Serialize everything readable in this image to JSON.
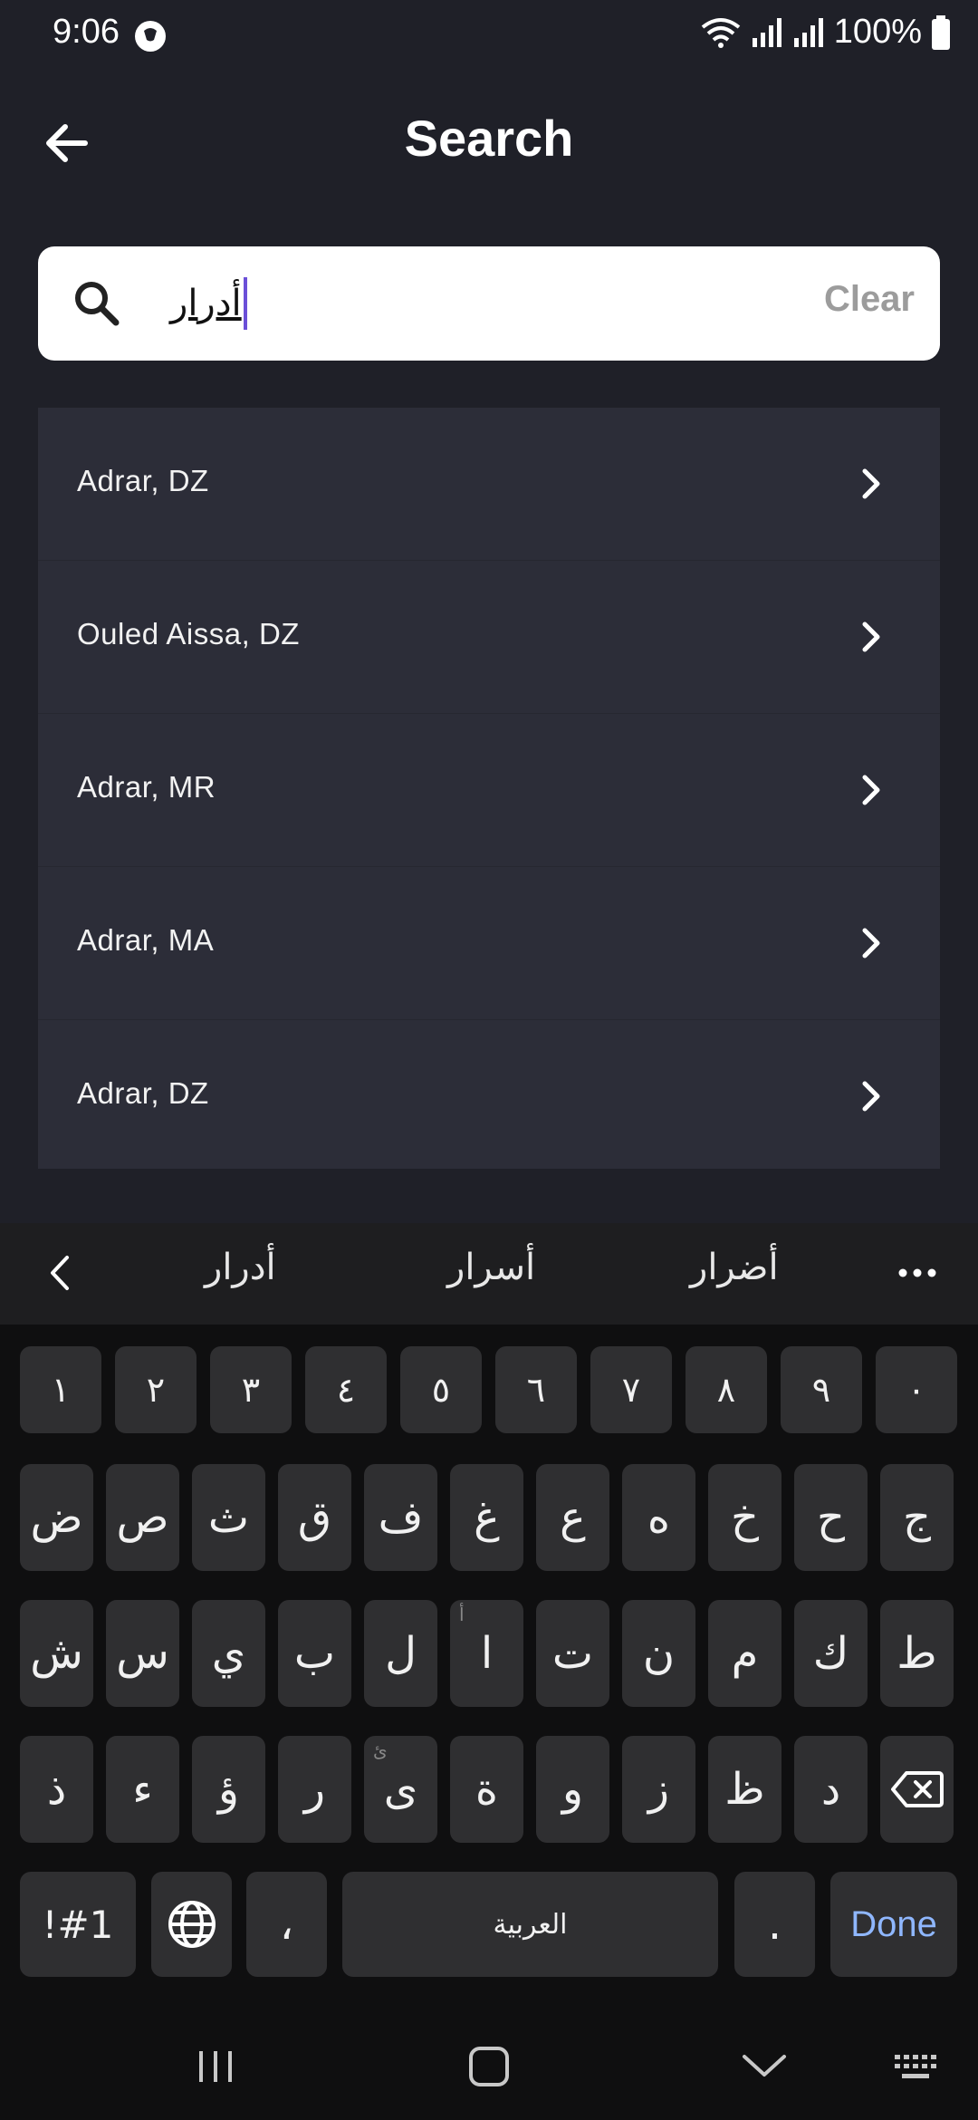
{
  "status_bar": {
    "time": "9:06",
    "battery": "100%"
  },
  "header": {
    "title": "Search"
  },
  "search": {
    "value": "أدرار",
    "clear_label": "Clear"
  },
  "results": [
    {
      "label": "Adrar, DZ"
    },
    {
      "label": "Ouled Aissa, DZ"
    },
    {
      "label": "Adrar, MR"
    },
    {
      "label": "Adrar, MA"
    },
    {
      "label": "Adrar, DZ"
    }
  ],
  "keyboard": {
    "suggestions": [
      "أدرار",
      "أسرار",
      "أضرار"
    ],
    "number_row": [
      "١",
      "٢",
      "٣",
      "٤",
      "٥",
      "٦",
      "٧",
      "٨",
      "٩",
      "٠"
    ],
    "row1": [
      "ض",
      "ص",
      "ث",
      "ق",
      "ف",
      "غ",
      "ع",
      "ه",
      "خ",
      "ح",
      "ج"
    ],
    "row2": [
      "ش",
      "س",
      "ي",
      "ب",
      "ل",
      "ا",
      "ت",
      "ن",
      "م",
      "ك",
      "ط"
    ],
    "row3": [
      "ذ",
      "ء",
      "ؤ",
      "ر",
      "ى",
      "ة",
      "و",
      "ز",
      "ظ",
      "د"
    ],
    "hint_alef": "أ",
    "hint_ya": "ئ",
    "symbols_label": "!#1",
    "comma_label": "،",
    "space_label": "العربية",
    "period_label": ".",
    "done_label": "Done"
  }
}
